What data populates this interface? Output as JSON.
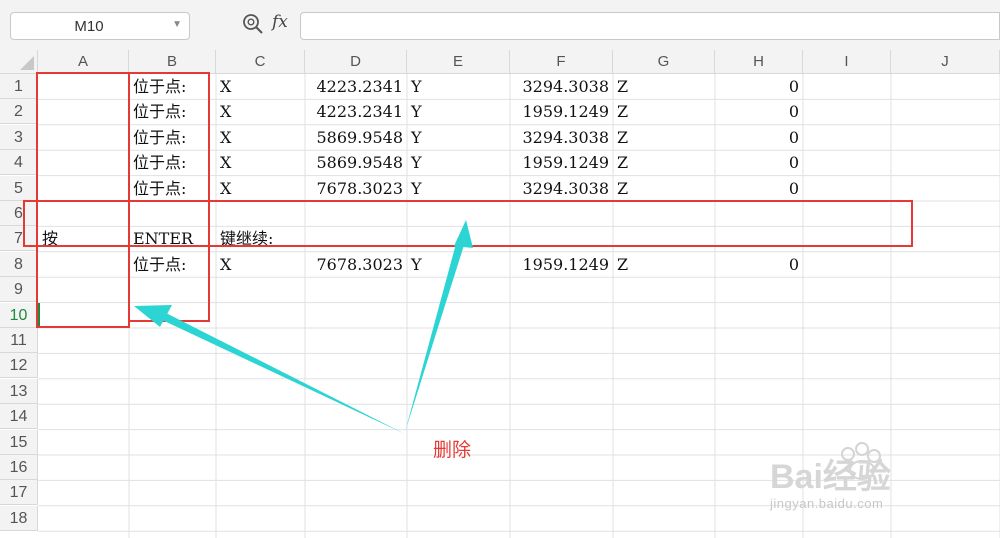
{
  "name_box": {
    "value": "M10"
  },
  "formula_bar": {
    "fx_label": "fx",
    "value": ""
  },
  "columns": [
    "A",
    "B",
    "C",
    "D",
    "E",
    "F",
    "G",
    "H",
    "I",
    "J"
  ],
  "rows": [
    "1",
    "2",
    "3",
    "4",
    "5",
    "6",
    "7",
    "8",
    "9",
    "10",
    "11",
    "12",
    "13",
    "14",
    "15",
    "16",
    "17",
    "18"
  ],
  "active_row": "10",
  "cells": [
    {
      "ref": "B1",
      "value": "位于点:"
    },
    {
      "ref": "C1",
      "value": "X"
    },
    {
      "ref": "D1",
      "value": "4223.2341"
    },
    {
      "ref": "E1",
      "value": "Y"
    },
    {
      "ref": "F1",
      "value": "3294.3038"
    },
    {
      "ref": "G1",
      "value": "Z"
    },
    {
      "ref": "H1",
      "value": "0"
    },
    {
      "ref": "B2",
      "value": "位于点:"
    },
    {
      "ref": "C2",
      "value": "X"
    },
    {
      "ref": "D2",
      "value": "4223.2341"
    },
    {
      "ref": "E2",
      "value": "Y"
    },
    {
      "ref": "F2",
      "value": "1959.1249"
    },
    {
      "ref": "G2",
      "value": "Z"
    },
    {
      "ref": "H2",
      "value": "0"
    },
    {
      "ref": "B3",
      "value": "位于点:"
    },
    {
      "ref": "C3",
      "value": "X"
    },
    {
      "ref": "D3",
      "value": "5869.9548"
    },
    {
      "ref": "E3",
      "value": "Y"
    },
    {
      "ref": "F3",
      "value": "3294.3038"
    },
    {
      "ref": "G3",
      "value": "Z"
    },
    {
      "ref": "H3",
      "value": "0"
    },
    {
      "ref": "B4",
      "value": "位于点:"
    },
    {
      "ref": "C4",
      "value": "X"
    },
    {
      "ref": "D4",
      "value": "5869.9548"
    },
    {
      "ref": "E4",
      "value": "Y"
    },
    {
      "ref": "F4",
      "value": "1959.1249"
    },
    {
      "ref": "G4",
      "value": "Z"
    },
    {
      "ref": "H4",
      "value": "0"
    },
    {
      "ref": "B5",
      "value": "位于点:"
    },
    {
      "ref": "C5",
      "value": "X"
    },
    {
      "ref": "D5",
      "value": "7678.3023"
    },
    {
      "ref": "E5",
      "value": "Y"
    },
    {
      "ref": "F5",
      "value": "3294.3038"
    },
    {
      "ref": "G5",
      "value": "Z"
    },
    {
      "ref": "H5",
      "value": "0"
    },
    {
      "ref": "A7",
      "value": "按"
    },
    {
      "ref": "B7",
      "value": "ENTER"
    },
    {
      "ref": "C7",
      "value": "键继续:"
    },
    {
      "ref": "B8",
      "value": "位于点:"
    },
    {
      "ref": "C8",
      "value": "X"
    },
    {
      "ref": "D8",
      "value": "7678.3023"
    },
    {
      "ref": "E8",
      "value": "Y"
    },
    {
      "ref": "F8",
      "value": "1959.1249"
    },
    {
      "ref": "G8",
      "value": "Z"
    },
    {
      "ref": "H8",
      "value": "0"
    }
  ],
  "annotation": {
    "label": "删除",
    "color": "#e53935",
    "arrow_color": "#2dd4d4"
  },
  "watermark": {
    "brand": "Bai经验",
    "url": "jingyan.baidu.com"
  }
}
